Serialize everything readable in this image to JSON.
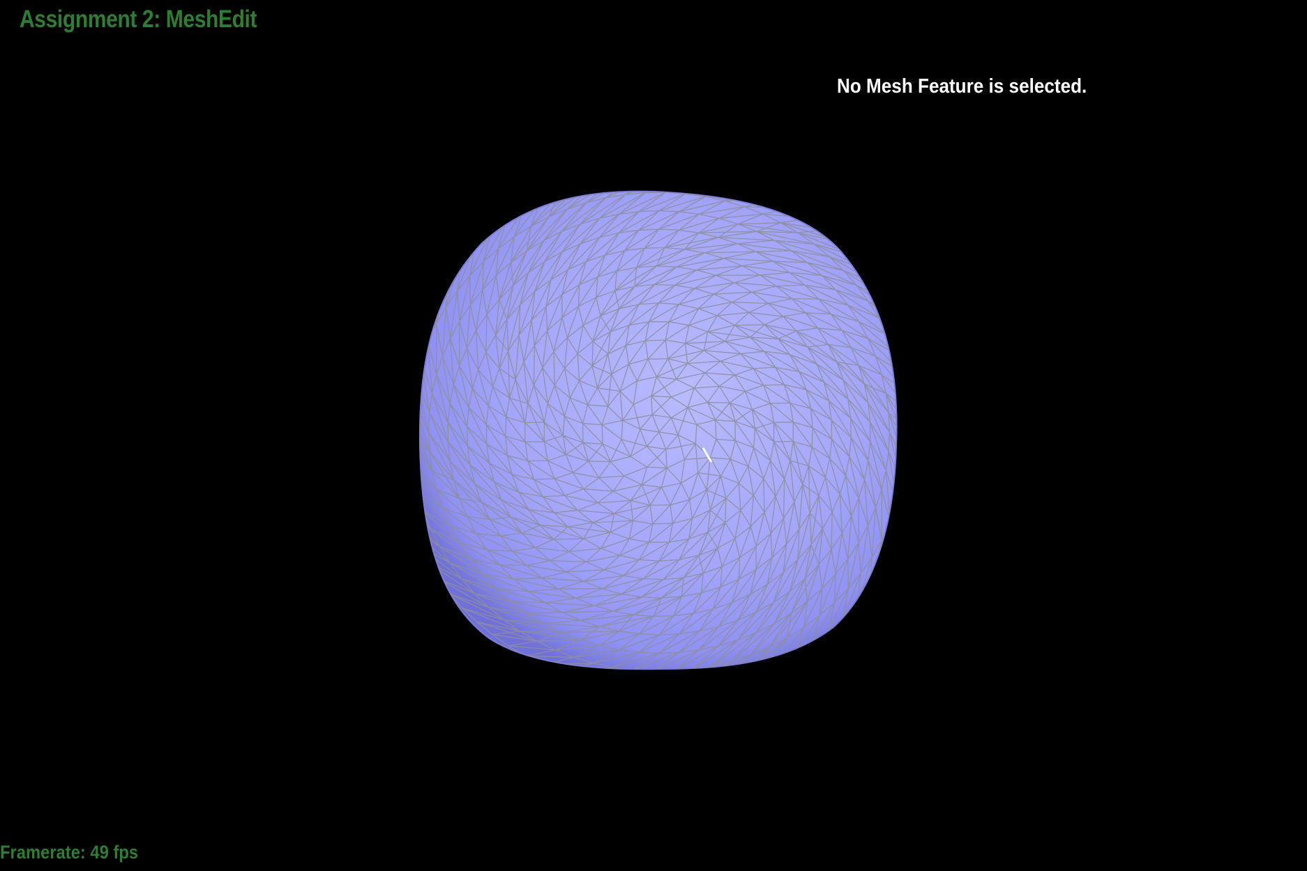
{
  "app": {
    "title": "Assignment 2: MeshEdit"
  },
  "hud": {
    "selection_status": "No Mesh Feature is selected.",
    "framerate_text": "Framerate: 49 fps"
  },
  "colors": {
    "background": "#000000",
    "title_green": "#2e7d32",
    "hud_text": "#ffffff",
    "mesh_fill_light": "#b3b6ff",
    "mesh_fill_dark": "#7a7cf0",
    "wireframe": "#8c8c9c",
    "cursor": "#ffffff"
  },
  "mesh": {
    "icon": "mesh-sphere-icon",
    "render_mode": "wireframe-shaded"
  }
}
